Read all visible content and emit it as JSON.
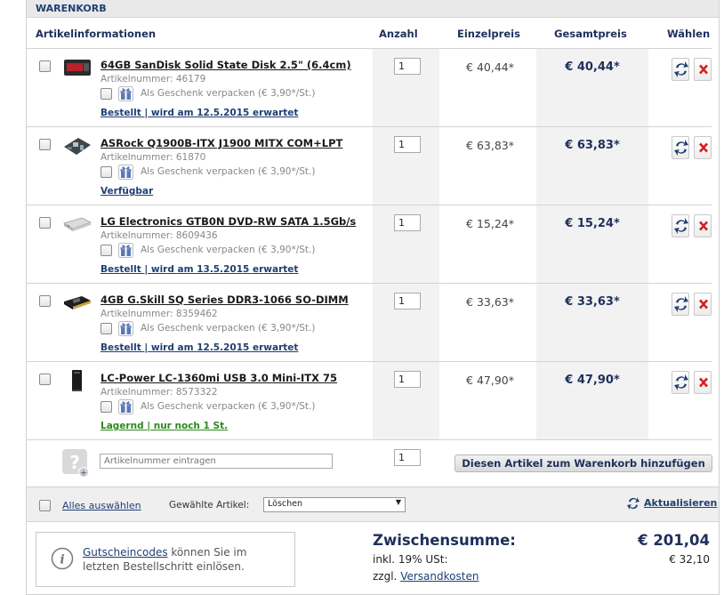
{
  "cart": {
    "title": "WARENKORB",
    "headers": {
      "article": "Artikelinformationen",
      "qty": "Anzahl",
      "unit_price": "Einzelpreis",
      "total_price": "Gesamtpreis",
      "select": "Wählen"
    },
    "items": [
      {
        "name": "64GB SanDisk Solid State Disk 2.5\" (6.4cm)",
        "artnr": "Artikelnummer: 46179",
        "gift": "Als Geschenk verpacken (€ 3,90*/St.)",
        "availability": "Bestellt | wird am 12.5.2015 erwartet",
        "availability_color": "#1f3f74",
        "qty": "1",
        "unit_price": "€ 40,44*",
        "total_price": "€ 40,44*",
        "thumb_icon": "ssd-icon"
      },
      {
        "name": "ASRock Q1900B-ITX J1900 MITX COM+LPT",
        "artnr": "Artikelnummer: 61870",
        "gift": "Als Geschenk verpacken (€ 3,90*/St.)",
        "availability": "Verfügbar",
        "availability_color": "#1f3f74",
        "qty": "1",
        "unit_price": "€ 63,83*",
        "total_price": "€ 63,83*",
        "thumb_icon": "mainboard-icon"
      },
      {
        "name": "LG Electronics GTB0N DVD-RW SATA 1.5Gb/s",
        "artnr": "Artikelnummer: 8609436",
        "gift": "Als Geschenk verpacken (€ 3,90*/St.)",
        "availability": "Bestellt | wird am 13.5.2015 erwartet",
        "availability_color": "#1f3f74",
        "qty": "1",
        "unit_price": "€ 15,24*",
        "total_price": "€ 15,24*",
        "thumb_icon": "dvd-drive-icon"
      },
      {
        "name": "4GB G.Skill SQ Series DDR3-1066 SO-DIMM",
        "artnr": "Artikelnummer: 8359462",
        "gift": "Als Geschenk verpacken (€ 3,90*/St.)",
        "availability": "Bestellt | wird am 12.5.2015 erwartet",
        "availability_color": "#1f3f74",
        "qty": "1",
        "unit_price": "€ 33,63*",
        "total_price": "€ 33,63*",
        "thumb_icon": "ram-icon"
      },
      {
        "name": "LC-Power LC-1360mi USB 3.0 Mini-ITX 75",
        "artnr": "Artikelnummer: 8573322",
        "gift": "Als Geschenk verpacken (€ 3,90*/St.)",
        "availability": "Lagernd | nur noch 1 St.",
        "availability_color": "#2a8a1a",
        "qty": "1",
        "unit_price": "€ 47,90*",
        "total_price": "€ 47,90*",
        "thumb_icon": "pc-case-icon"
      }
    ],
    "add_row": {
      "placeholder": "Artikelnummer eintragen",
      "qty": "1",
      "button": "Diesen Artikel zum Warenkorb hinzufügen"
    },
    "actions": {
      "select_all": "Alles auswählen",
      "selected_label": "Gewählte Artikel:",
      "selected_action": "Löschen",
      "update": "Aktualisieren"
    },
    "voucher": {
      "link": "Gutscheincodes",
      "text1": " können Sie im",
      "text2": "letzten Bestellschritt einlösen."
    },
    "summary": {
      "subtotal_label": "Zwischensumme:",
      "subtotal_value": "€ 201,04",
      "vat_label": "inkl. 19% USt:",
      "vat_value": "€ 32,10",
      "shipping_prefix": "zzgl.",
      "shipping_link": "Versandkosten"
    }
  },
  "colors": {
    "accent": "#1f3f74",
    "delete": "#d21f1f",
    "available_green": "#2a8a1a"
  }
}
